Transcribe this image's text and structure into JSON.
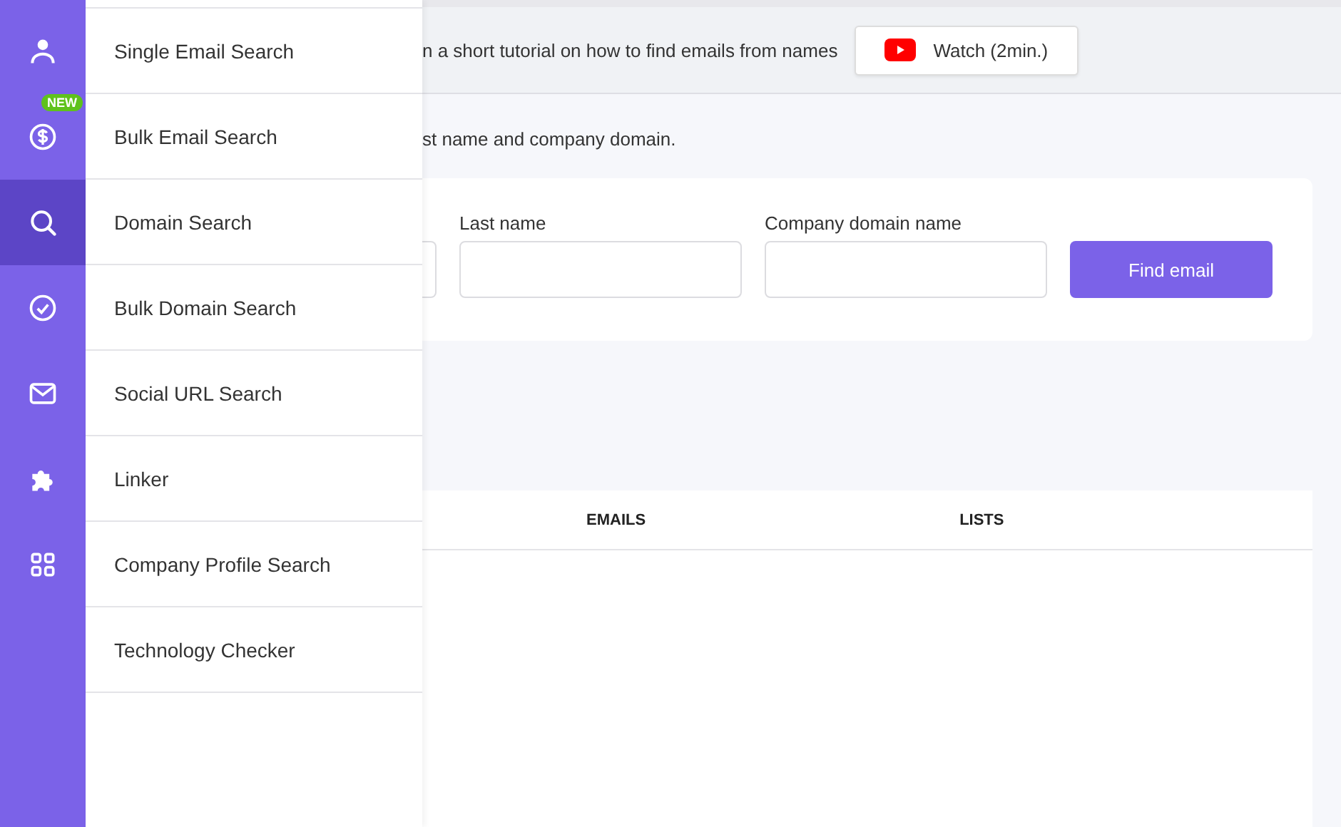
{
  "rail": [
    {
      "kind": "user",
      "selected": false
    },
    {
      "kind": "coin",
      "selected": false,
      "badge": "NEW"
    },
    {
      "kind": "search",
      "selected": true
    },
    {
      "kind": "check",
      "selected": false
    },
    {
      "kind": "mail",
      "selected": false
    },
    {
      "kind": "puzzle",
      "selected": false
    },
    {
      "kind": "apps",
      "selected": false
    }
  ],
  "menu": [
    "Single Email Search",
    "Bulk Email Search",
    "Domain Search",
    "Bulk Domain Search",
    "Social URL Search",
    "Linker",
    "Company Profile Search",
    "Technology Checker"
  ],
  "tutorial": {
    "text": "n a short tutorial on how to find emails from names",
    "button": "Watch (2min.)"
  },
  "description": "st name and company domain.",
  "form": {
    "fields": [
      {
        "kind": "cut"
      },
      {
        "kind": "full",
        "label": "Last name"
      },
      {
        "kind": "full",
        "label": "Company domain name"
      }
    ],
    "button": "Find email"
  },
  "table": {
    "columns": [
      "EMAILS",
      "LISTS"
    ]
  }
}
